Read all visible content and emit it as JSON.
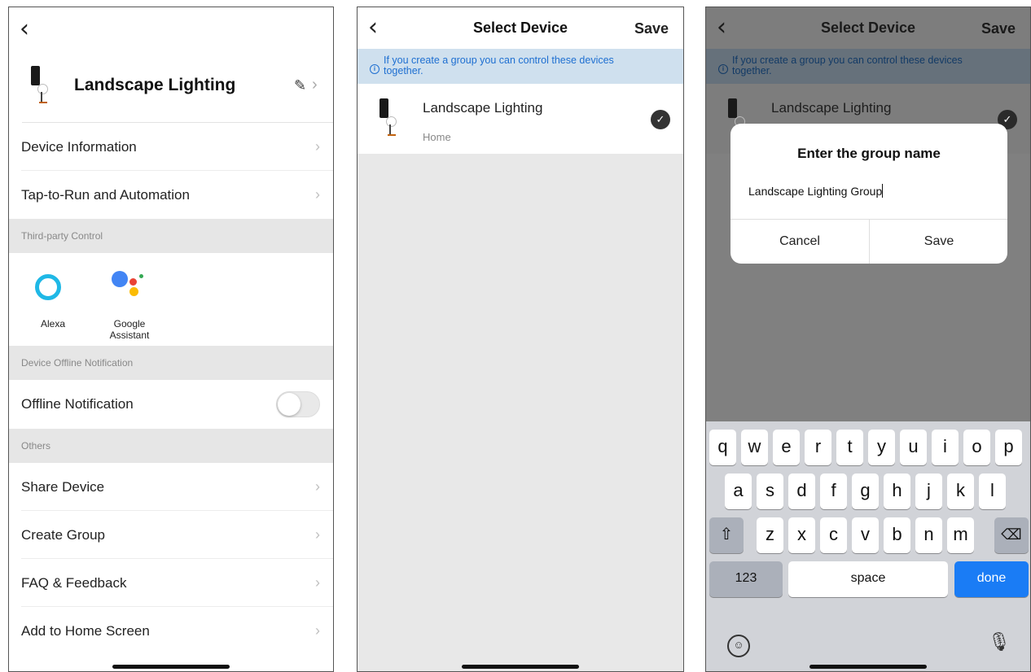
{
  "screen1": {
    "device_name": "Landscape Lighting",
    "rows": {
      "device_info": "Device Information",
      "tap_to_run": "Tap-to-Run and Automation"
    },
    "section_third_party": "Third-party Control",
    "alexa_label": "Alexa",
    "google_label_1": "Google",
    "google_label_2": "Assistant",
    "section_offline": "Device Offline Notification",
    "offline_label": "Offline Notification",
    "offline_enabled": false,
    "section_others": "Others",
    "others": {
      "share": "Share Device",
      "create_group": "Create Group",
      "faq": "FAQ & Feedback",
      "add_home": "Add to Home Screen"
    }
  },
  "screen2": {
    "title": "Select Device",
    "save": "Save",
    "banner": "If you create a group you can control these devices together.",
    "device_name": "Landscape Lighting",
    "device_room": "Home"
  },
  "screen3": {
    "title": "Select Device",
    "save": "Save",
    "banner": "If you create a group you can control these devices together.",
    "device_name": "Landscape Lighting",
    "dialog": {
      "title": "Enter the group name",
      "value": "Landscape Lighting Group",
      "cancel": "Cancel",
      "save": "Save"
    },
    "keyboard": {
      "row1": [
        "q",
        "w",
        "e",
        "r",
        "t",
        "y",
        "u",
        "i",
        "o",
        "p"
      ],
      "row2": [
        "a",
        "s",
        "d",
        "f",
        "g",
        "h",
        "j",
        "k",
        "l"
      ],
      "row3": [
        "z",
        "x",
        "c",
        "v",
        "b",
        "n",
        "m"
      ],
      "numbers": "123",
      "space": "space",
      "done": "done"
    }
  },
  "colors": {
    "accent": "#1a7cf5",
    "banner_text": "#1e6fd1",
    "banner_bg": "#cfe0ee"
  }
}
